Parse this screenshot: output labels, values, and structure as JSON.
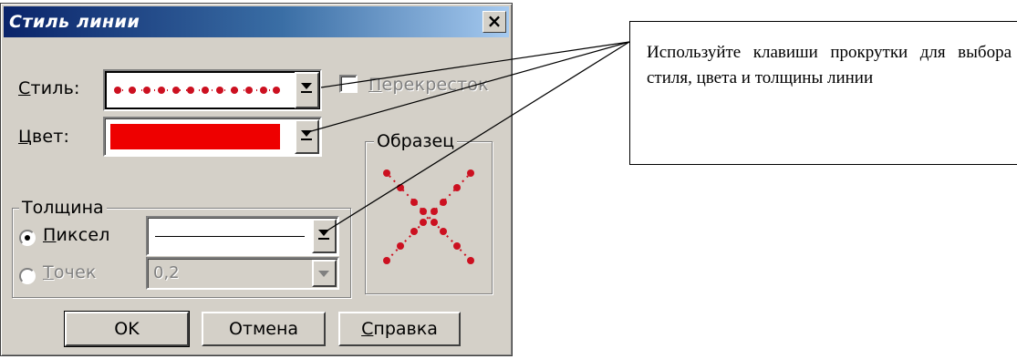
{
  "dialog": {
    "title": "Стиль линии",
    "close_glyph": "×"
  },
  "style_field": {
    "label_first": "С",
    "label_rest": "тиль:"
  },
  "crossing_checkbox": {
    "label_first": "П",
    "label_rest": "ерекресток",
    "checked": false,
    "enabled": false
  },
  "color_field": {
    "label_first": "Ц",
    "label_rest": "вет:",
    "value": "#ee0000"
  },
  "sample": {
    "title": "Образец",
    "color": "#cc1020"
  },
  "thickness": {
    "title": "Толщина",
    "pixel": {
      "label_first": "П",
      "label_rest": "иксел",
      "selected": true
    },
    "points": {
      "label_first": "Т",
      "label_rest": "очек",
      "value": "0,2",
      "selected": false
    }
  },
  "buttons": {
    "ok": "OK",
    "cancel": "Отмена",
    "help_first": "С",
    "help_rest": "правка"
  },
  "callout_text": "Используйте клавиши прокрутки для выбора стиля, цвета и толщины линии",
  "colors": {
    "title_start": "#0a246a",
    "title_end": "#a6caf0",
    "line_style": "#cc1020"
  }
}
